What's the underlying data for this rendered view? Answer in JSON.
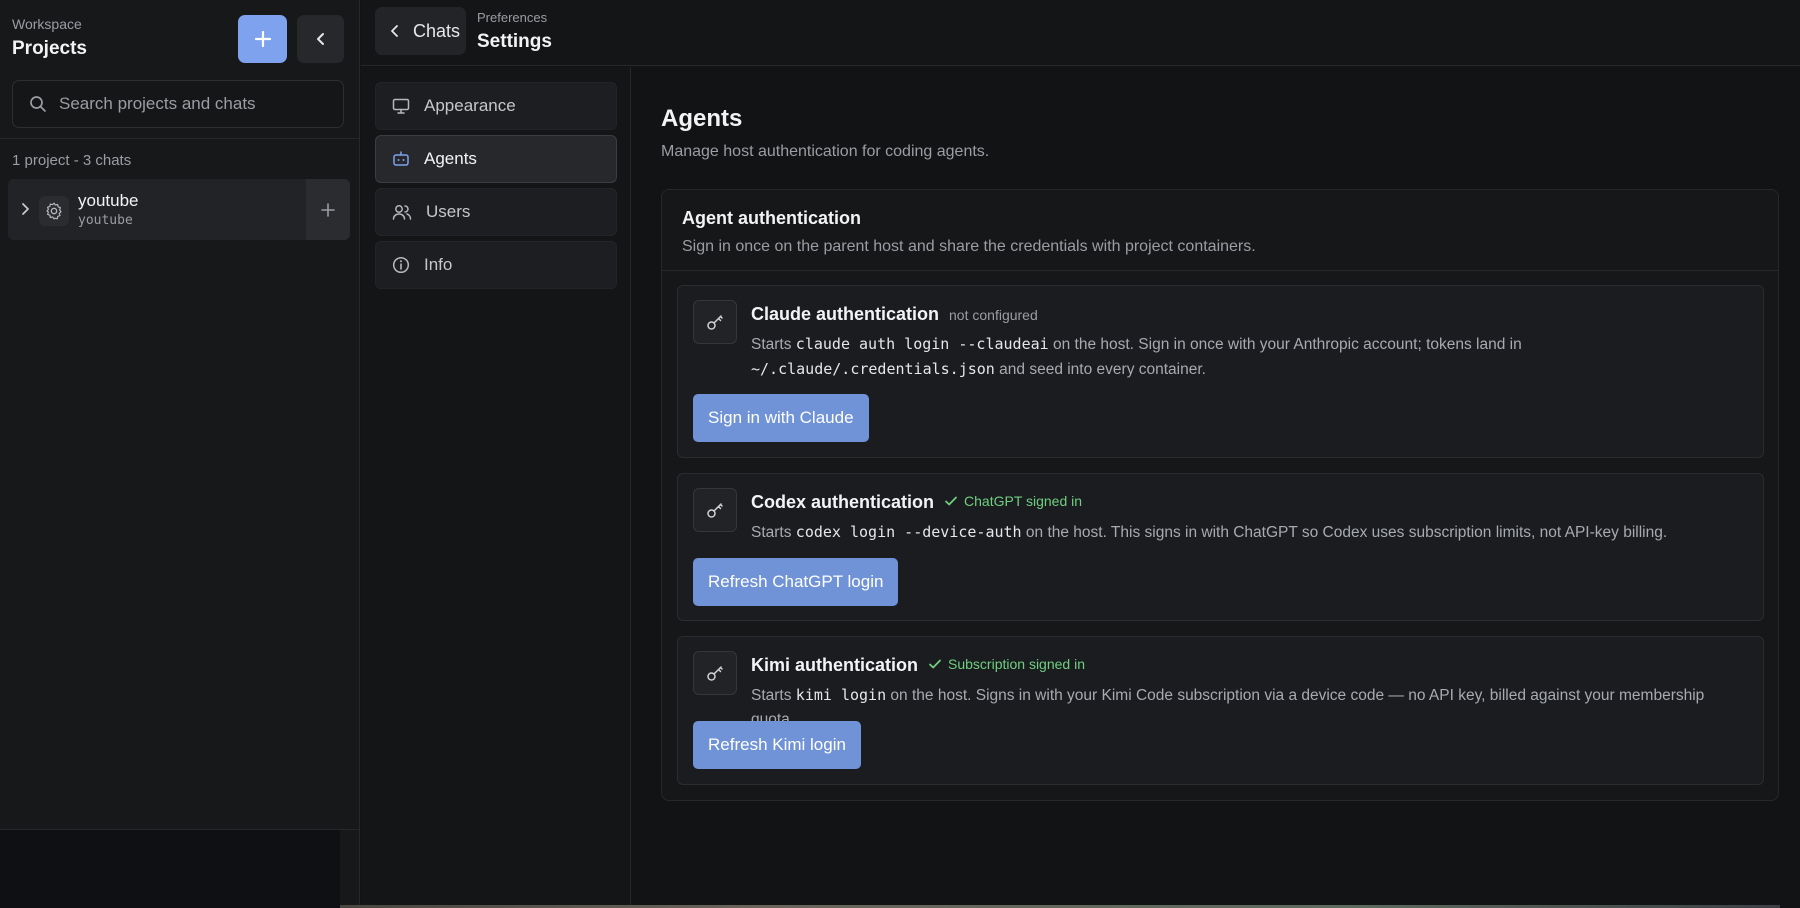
{
  "sidebar": {
    "eyebrow": "Workspace",
    "title": "Projects",
    "search_placeholder": "Search projects and chats",
    "count_text": "1 project - 3 chats",
    "projects": [
      {
        "name": "youtube",
        "sub": "youtube"
      }
    ]
  },
  "topbar": {
    "back_label": "Chats",
    "eyebrow": "Preferences",
    "title": "Settings"
  },
  "nav": {
    "items": [
      {
        "label": "Appearance",
        "icon": "monitor-icon"
      },
      {
        "label": "Agents",
        "icon": "bot-icon",
        "active": true
      },
      {
        "label": "Users",
        "icon": "users-icon"
      },
      {
        "label": "Info",
        "icon": "info-icon"
      }
    ]
  },
  "main": {
    "title": "Agents",
    "subtitle": "Manage host authentication for coding agents.",
    "card": {
      "title": "Agent authentication",
      "subtitle": "Sign in once on the parent host and share the credentials with project containers.",
      "claude": {
        "name": "Claude authentication",
        "status": "not configured",
        "d1": "Starts",
        "c1": "claude auth login --claudeai",
        "d2": "on the host. Sign in once with your Anthropic account; tokens land in",
        "c2": "~/.claude/.credentials.json",
        "d3": "and seed into every container.",
        "button": "Sign in with Claude"
      },
      "codex": {
        "name": "Codex authentication",
        "status": "ChatGPT signed in",
        "d1": "Starts",
        "c1": "codex login --device-auth",
        "d2": "on the host. This signs in with ChatGPT so Codex uses subscription limits, not API-key billing.",
        "button": "Refresh ChatGPT login"
      },
      "kimi": {
        "name": "Kimi authentication",
        "status": "Subscription signed in",
        "d1": "Starts",
        "c1": "kimi login",
        "d2": "on the host. Signs in with your Kimi Code subscription via a device code — no API key, billed against your membership quota.",
        "button": "Refresh Kimi login"
      }
    }
  },
  "colors": {
    "accent": "#7ea2ee",
    "action": "#7092d6",
    "success": "#6fcf7f",
    "background": "#121315"
  }
}
